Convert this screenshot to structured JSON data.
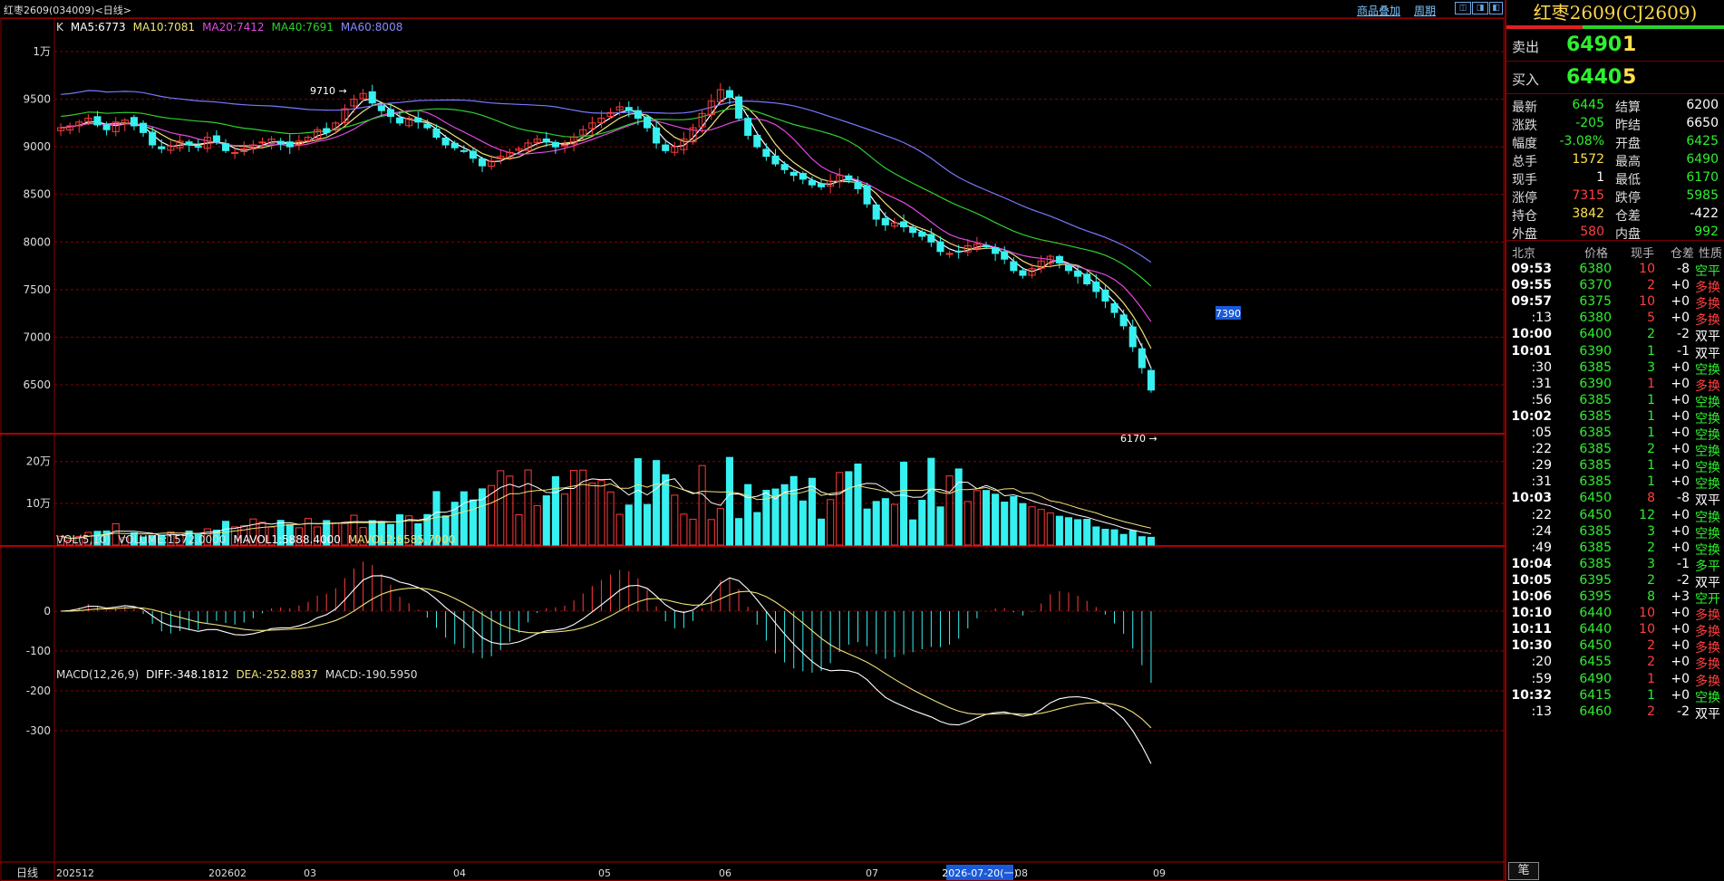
{
  "window": {
    "title": "红枣2609(034009)<日线>",
    "links": [
      "商品叠加",
      "周期"
    ],
    "mini_buttons": [
      "◫",
      "◨",
      "◧"
    ]
  },
  "colors": {
    "up": "#ff3b3b",
    "down": "#37f0f0",
    "ma5": "#ffffff",
    "ma10": "#f0e27a",
    "ma20": "#e04ae0",
    "ma40": "#2ed02e",
    "ma60": "#7878ff",
    "grid": "#8b0000"
  },
  "main_panel": {
    "legend": [
      {
        "text": "K",
        "color": "#dddddd"
      },
      {
        "text": "MA5:6773",
        "color": "#ffffff"
      },
      {
        "text": "MA10:7081",
        "color": "#f0e27a"
      },
      {
        "text": "MA20:7412",
        "color": "#e04ae0"
      },
      {
        "text": "MA40:7691",
        "color": "#2ed02e"
      },
      {
        "text": "MA60:8008",
        "color": "#8a8aff"
      }
    ],
    "y_labels": [
      "1万",
      "9500",
      "9000",
      "8500",
      "8000",
      "7500",
      "7000",
      "6500"
    ],
    "high_label": "9710",
    "low_label": "6170",
    "price_tag": "7390"
  },
  "volume_panel": {
    "legend": [
      {
        "text": "VOL(5,10)",
        "color": "#dddddd"
      },
      {
        "text": "VOLUME:1572.0000",
        "color": "#dddddd"
      },
      {
        "text": "MAVOL1:5888.4000",
        "color": "#ffffff"
      },
      {
        "text": "MAVOL2:6585.7000",
        "color": "#f0e27a"
      }
    ],
    "y_labels": [
      "20万",
      "10万"
    ]
  },
  "macd_panel": {
    "legend": [
      {
        "text": "MACD(12,26,9)",
        "color": "#dddddd"
      },
      {
        "text": "DIFF:-348.1812",
        "color": "#ffffff"
      },
      {
        "text": "DEA:-252.8837",
        "color": "#f0e27a"
      },
      {
        "text": "MACD:-190.5950",
        "color": "#dddddd"
      }
    ],
    "y_labels": [
      "0",
      "-100",
      "-200",
      "-300"
    ]
  },
  "x_axis": {
    "mode_label": "日线",
    "labels": [
      "202512",
      "202602",
      "03",
      "04",
      "05",
      "06",
      "07",
      "08",
      "09"
    ],
    "cursor_date": "2026-07-20(一)"
  },
  "quote": {
    "name": "红枣2609(CJ2609)",
    "ask": {
      "label": "卖出",
      "price": "6490",
      "qty": "1"
    },
    "bid": {
      "label": "买入",
      "price": "6440",
      "qty": "5"
    },
    "stats": [
      {
        "k1": "最新",
        "v1": "6445",
        "c1": "green",
        "k2": "结算",
        "v2": "6200",
        "c2": "white"
      },
      {
        "k1": "涨跌",
        "v1": "-205",
        "c1": "green",
        "k2": "昨结",
        "v2": "6650",
        "c2": "white"
      },
      {
        "k1": "幅度",
        "v1": "-3.08%",
        "c1": "green",
        "k2": "开盘",
        "v2": "6425",
        "c2": "green"
      },
      {
        "k1": "总手",
        "v1": "1572",
        "c1": "yellow",
        "k2": "最高",
        "v2": "6490",
        "c2": "green"
      },
      {
        "k1": "现手",
        "v1": "1",
        "c1": "white",
        "k2": "最低",
        "v2": "6170",
        "c2": "green"
      },
      {
        "k1": "涨停",
        "v1": "7315",
        "c1": "red",
        "k2": "跌停",
        "v2": "5985",
        "c2": "green"
      },
      {
        "k1": "持仓",
        "v1": "3842",
        "c1": "yellow",
        "k2": "仓差",
        "v2": "-422",
        "c2": "white"
      },
      {
        "k1": "外盘",
        "v1": "580",
        "c1": "red",
        "k2": "内盘",
        "v2": "992",
        "c2": "green"
      }
    ],
    "tick_header": [
      "北京",
      "价格",
      "现手",
      "仓差",
      "性质"
    ],
    "ticks": [
      {
        "t": "09:53",
        "p": "6380",
        "q": "10",
        "qc": "red",
        "d": "-8",
        "n": "空平",
        "nc": "green"
      },
      {
        "t": "09:55",
        "p": "6370",
        "q": "2",
        "qc": "red",
        "d": "+0",
        "n": "多换",
        "nc": "red"
      },
      {
        "t": "09:57",
        "p": "6375",
        "q": "10",
        "qc": "red",
        "d": "+0",
        "n": "多换",
        "nc": "red"
      },
      {
        "t": ":13",
        "p": "6380",
        "q": "5",
        "qc": "red",
        "d": "+0",
        "n": "多换",
        "nc": "red"
      },
      {
        "t": "10:00",
        "p": "6400",
        "q": "2",
        "qc": "green",
        "d": "-2",
        "n": "双平",
        "nc": "white"
      },
      {
        "t": "10:01",
        "p": "6390",
        "q": "1",
        "qc": "green",
        "d": "-1",
        "n": "双平",
        "nc": "white"
      },
      {
        "t": ":30",
        "p": "6385",
        "q": "3",
        "qc": "green",
        "d": "+0",
        "n": "空换",
        "nc": "green"
      },
      {
        "t": ":31",
        "p": "6390",
        "q": "1",
        "qc": "red",
        "d": "+0",
        "n": "多换",
        "nc": "red"
      },
      {
        "t": ":56",
        "p": "6385",
        "q": "1",
        "qc": "green",
        "d": "+0",
        "n": "空换",
        "nc": "green"
      },
      {
        "t": "10:02",
        "p": "6385",
        "q": "1",
        "qc": "green",
        "d": "+0",
        "n": "空换",
        "nc": "green"
      },
      {
        "t": ":05",
        "p": "6385",
        "q": "1",
        "qc": "green",
        "d": "+0",
        "n": "空换",
        "nc": "green"
      },
      {
        "t": ":22",
        "p": "6385",
        "q": "2",
        "qc": "green",
        "d": "+0",
        "n": "空换",
        "nc": "green"
      },
      {
        "t": ":29",
        "p": "6385",
        "q": "1",
        "qc": "green",
        "d": "+0",
        "n": "空换",
        "nc": "green"
      },
      {
        "t": ":31",
        "p": "6385",
        "q": "1",
        "qc": "green",
        "d": "+0",
        "n": "空换",
        "nc": "green"
      },
      {
        "t": "10:03",
        "p": "6450",
        "q": "8",
        "qc": "red",
        "d": "-8",
        "n": "双平",
        "nc": "white"
      },
      {
        "t": ":22",
        "p": "6450",
        "q": "12",
        "qc": "green",
        "d": "+0",
        "n": "空换",
        "nc": "green"
      },
      {
        "t": ":24",
        "p": "6385",
        "q": "3",
        "qc": "green",
        "d": "+0",
        "n": "空换",
        "nc": "green"
      },
      {
        "t": ":49",
        "p": "6385",
        "q": "2",
        "qc": "green",
        "d": "+0",
        "n": "空换",
        "nc": "green"
      },
      {
        "t": "10:04",
        "p": "6385",
        "q": "3",
        "qc": "green",
        "d": "-1",
        "n": "多平",
        "nc": "green"
      },
      {
        "t": "10:05",
        "p": "6395",
        "q": "2",
        "qc": "green",
        "d": "-2",
        "n": "双平",
        "nc": "white"
      },
      {
        "t": "10:06",
        "p": "6395",
        "q": "8",
        "qc": "green",
        "d": "+3",
        "n": "空开",
        "nc": "green"
      },
      {
        "t": "10:10",
        "p": "6440",
        "q": "10",
        "qc": "red",
        "d": "+0",
        "n": "多换",
        "nc": "red"
      },
      {
        "t": "10:11",
        "p": "6440",
        "q": "10",
        "qc": "red",
        "d": "+0",
        "n": "多换",
        "nc": "red"
      },
      {
        "t": "10:30",
        "p": "6450",
        "q": "2",
        "qc": "red",
        "d": "+0",
        "n": "多换",
        "nc": "red"
      },
      {
        "t": ":20",
        "p": "6455",
        "q": "2",
        "qc": "red",
        "d": "+0",
        "n": "多换",
        "nc": "red"
      },
      {
        "t": ":59",
        "p": "6490",
        "q": "1",
        "qc": "red",
        "d": "+0",
        "n": "多换",
        "nc": "red"
      },
      {
        "t": "10:32",
        "p": "6415",
        "q": "1",
        "qc": "green",
        "d": "+0",
        "n": "空换",
        "nc": "green"
      },
      {
        "t": ":13",
        "p": "6460",
        "q": "2",
        "qc": "red",
        "d": "-2",
        "n": "双平",
        "nc": "white"
      }
    ],
    "bottom_tab": "笔"
  },
  "chart_data": {
    "type": "candlestick",
    "start_date": "2025-12",
    "x_ticks": [
      "202512",
      "202602",
      "03",
      "04",
      "05",
      "06",
      "07",
      "08",
      "09"
    ],
    "ylim": [
      6100,
      10100
    ],
    "close_samples": [
      9200,
      9220,
      9260,
      9300,
      9230,
      9180,
      9260,
      9280,
      9220,
      9150,
      9020,
      8980,
      9010,
      9060,
      9020,
      9000,
      9100,
      9050,
      8960,
      8940,
      8980,
      9020,
      9050,
      9080,
      9030,
      9000,
      9060,
      9100,
      9180,
      9150,
      9250,
      9400,
      9500,
      9560,
      9460,
      9380,
      9320,
      9250,
      9300,
      9260,
      9200,
      9100,
      9020,
      8990,
      8960,
      8880,
      8800,
      8850,
      8900,
      8940,
      8980,
      9040,
      9080,
      9050,
      9000,
      9020,
      9100,
      9180,
      9250,
      9300,
      9360,
      9420,
      9380,
      9300,
      9200,
      9040,
      8960,
      9000,
      9080,
      9200,
      9350,
      9480,
      9600,
      9520,
      9300,
      9120,
      9000,
      8900,
      8820,
      8760,
      8700,
      8660,
      8600,
      8580,
      8640,
      8700,
      8650,
      8560,
      8400,
      8240,
      8180,
      8200,
      8160,
      8100,
      8060,
      8000,
      7900,
      7880,
      7900,
      7960,
      7980,
      7950,
      7880,
      7820,
      7700,
      7650,
      7720,
      7800,
      7850,
      7780,
      7700,
      7640,
      7560,
      7480,
      7380,
      7260,
      7120,
      6900,
      6680,
      6445
    ],
    "ma_last": {
      "MA5": 6773,
      "MA10": 7081,
      "MA20": 7412,
      "MA40": 7691,
      "MA60": 8008
    },
    "high": 9710,
    "low": 6170,
    "volume": {
      "last": 1572,
      "mavol1": 5888.4,
      "mavol2": 6585.7,
      "ylim": [
        0,
        260000
      ]
    },
    "macd": {
      "diff": -348.1812,
      "dea": -252.8837,
      "macd": -190.595,
      "ylim": [
        -350,
        100
      ]
    }
  }
}
